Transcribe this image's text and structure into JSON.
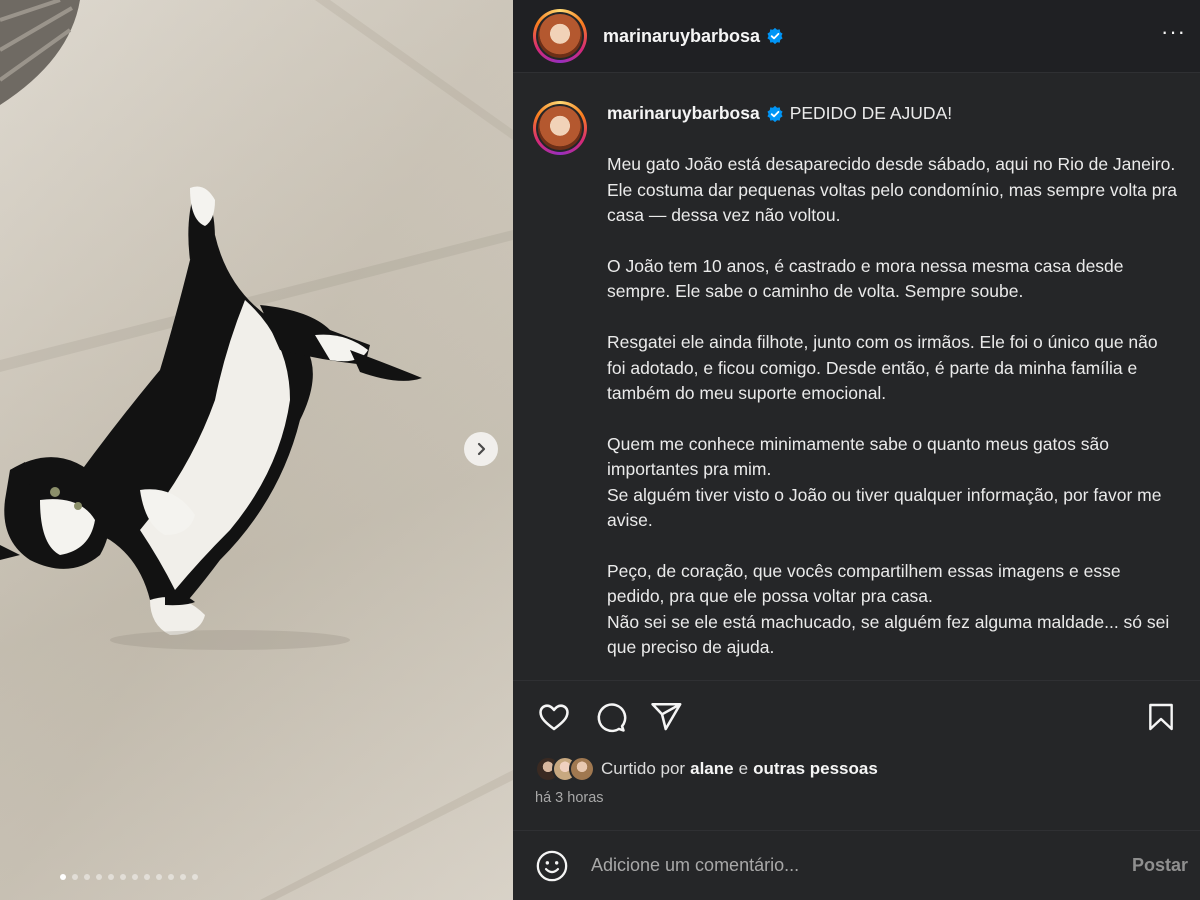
{
  "post": {
    "username": "marinaruybarbosa",
    "verified": true
  },
  "caption": {
    "username": "marinaruybarbosa",
    "title": "PEDIDO DE AJUDA!",
    "paragraphs": [
      "Meu gato João está desaparecido desde sábado, aqui no Rio de Janeiro. Ele costuma dar pequenas voltas pelo condomínio, mas sempre volta pra casa — dessa vez não voltou.",
      "O João tem 10 anos, é castrado e mora nessa mesma casa desde sempre. Ele sabe o caminho de volta. Sempre soube.",
      "Resgatei ele ainda filhote, junto com os irmãos. Ele foi o único que não foi adotado, e ficou comigo. Desde então, é parte da minha família e também do meu suporte emocional.",
      "Quem me conhece minimamente sabe o quanto meus gatos são importantes pra mim.\nSe alguém tiver visto o João ou tiver qualquer informação, por favor me avise.",
      "Peço, de coração, que vocês compartilhem essas imagens e esse pedido, pra que ele possa voltar pra casa.\nNão sei se ele está machucado, se alguém fez alguma maldade... só sei que preciso de ajuda."
    ]
  },
  "likes": {
    "prefix": "Curtido por",
    "user": "alane",
    "conjunction": "e",
    "others": "outras pessoas"
  },
  "time": "há 3 horas",
  "comment": {
    "placeholder": "Adicione um comentário...",
    "post_label": "Postar"
  },
  "carousel": {
    "slide_count": 12,
    "active_index": 0
  },
  "icons": {
    "verified": "verified-badge-icon",
    "more": "more-options-icon",
    "like": "heart-icon",
    "comment": "comment-bubble-icon",
    "share": "paper-plane-icon",
    "save": "bookmark-icon",
    "emoji": "smiley-icon",
    "next": "chevron-right-icon"
  },
  "colors": {
    "panel_bg": "#252628",
    "verified_blue": "#0095f6",
    "muted_text": "#a8a8a8"
  }
}
